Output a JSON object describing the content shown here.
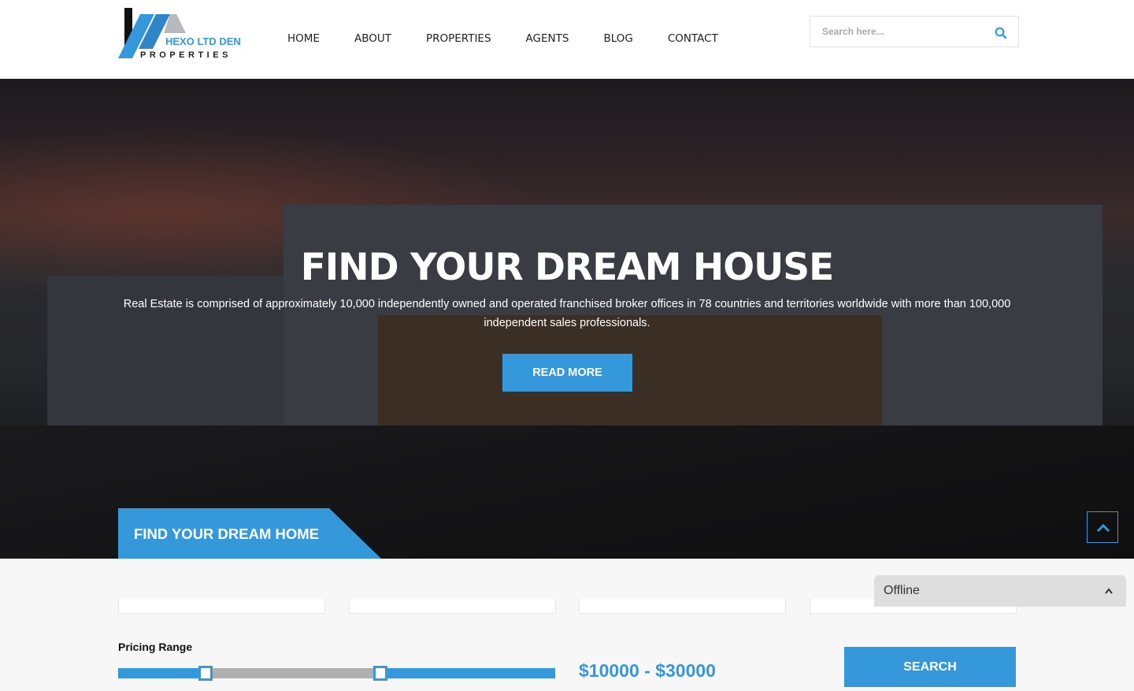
{
  "brand": {
    "line1": "HEXO LTD DEN",
    "line2": "PROPERTIES",
    "accent": "#3498db"
  },
  "nav": [
    "HOME",
    "ABOUT",
    "PROPERTIES",
    "AGENTS",
    "BLOG",
    "CONTACT"
  ],
  "search": {
    "placeholder": "Search here...",
    "icon": "search-icon"
  },
  "hero": {
    "title": "FIND YOUR DREAM HOUSE",
    "description": "Real Estate is comprised of approximately 10,000 independently owned and operated franchised broker offices in 78 countries and territories worldwide with more than 100,000 independent sales professionals.",
    "button": "READ MORE"
  },
  "finder": {
    "tab_label": "FIND YOUR DREAM HOME",
    "pricing_label": "Pricing Range",
    "price_text": "$10000 - $30000",
    "range_min_fraction": 0.2,
    "range_max_fraction": 0.6,
    "search_button": "SEARCH"
  },
  "chat": {
    "status": "Offline"
  },
  "back_to_top_icon": "chevron-up-icon"
}
